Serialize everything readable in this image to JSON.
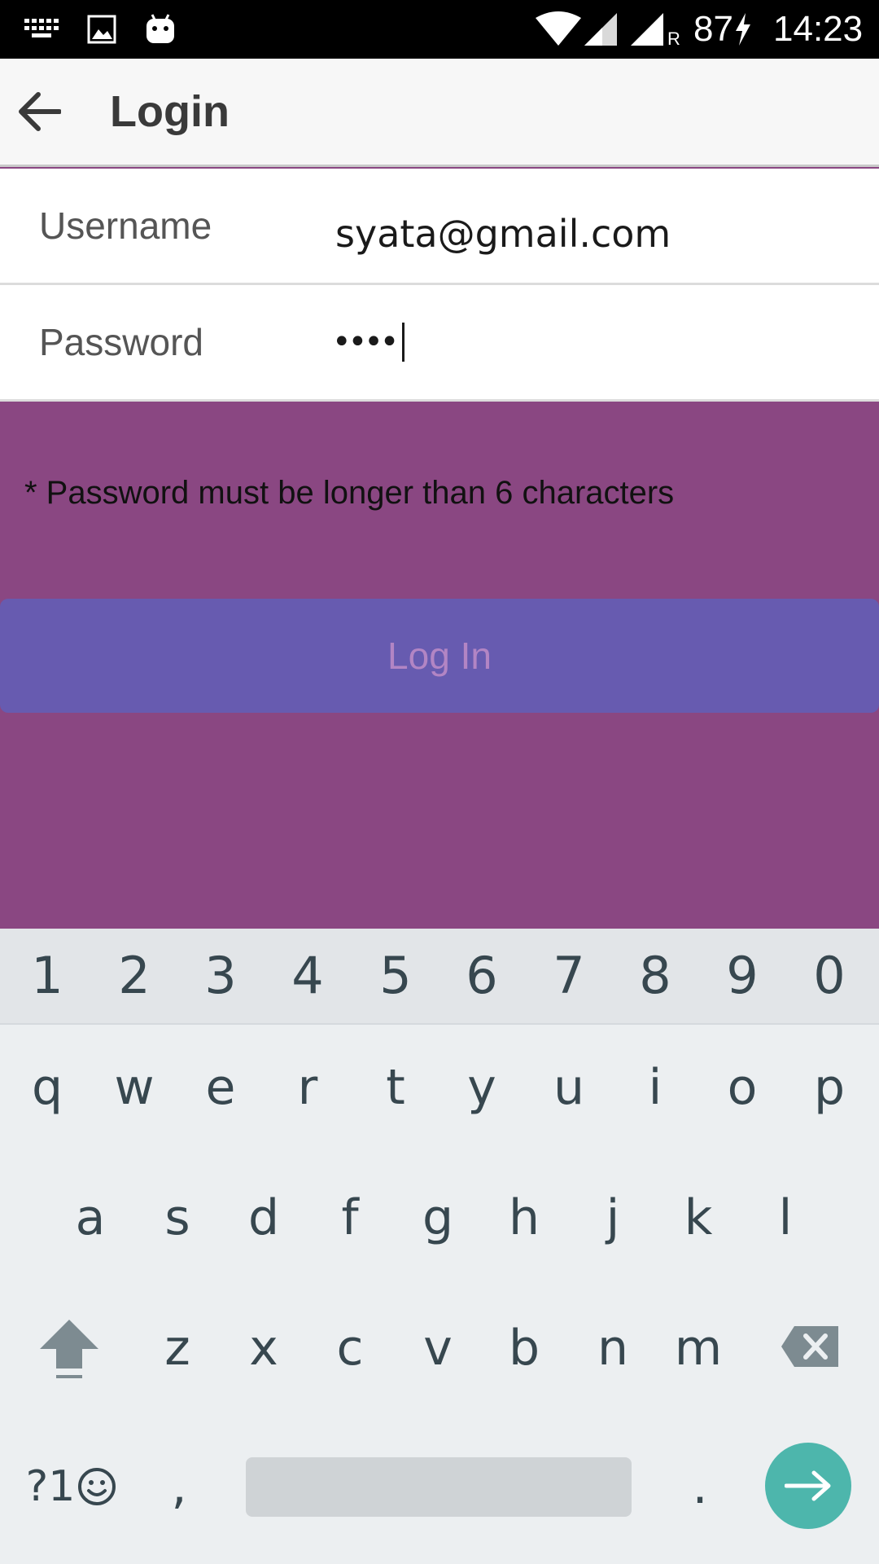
{
  "status_bar": {
    "battery": "87",
    "time": "14:23",
    "icons": [
      "keyboard-icon",
      "image-icon",
      "android-icon",
      "wifi-icon",
      "signal-icon",
      "signal-roaming-icon",
      "charging-icon"
    ],
    "roaming_label": "R"
  },
  "app_bar": {
    "title": "Login",
    "back_icon": "arrow-back-icon"
  },
  "form": {
    "username": {
      "label": "Username",
      "value": "syata@gmail.com"
    },
    "password": {
      "label": "Password",
      "masked_value": "••••"
    },
    "error": "* Password must be longer than 6 characters",
    "login_button": "Log In"
  },
  "colors": {
    "background": "#8a4782",
    "button": "#675bb0",
    "button_text": "#b285c4",
    "enter_key": "#4db6ac"
  },
  "keyboard": {
    "numbers": [
      "1",
      "2",
      "3",
      "4",
      "5",
      "6",
      "7",
      "8",
      "9",
      "0"
    ],
    "row1": [
      "q",
      "w",
      "e",
      "r",
      "t",
      "y",
      "u",
      "i",
      "o",
      "p"
    ],
    "row2": [
      "a",
      "s",
      "d",
      "f",
      "g",
      "h",
      "j",
      "k",
      "l"
    ],
    "row3": [
      "z",
      "x",
      "c",
      "v",
      "b",
      "n",
      "m"
    ],
    "symbols_key": "?1",
    "comma": ",",
    "period": "."
  }
}
